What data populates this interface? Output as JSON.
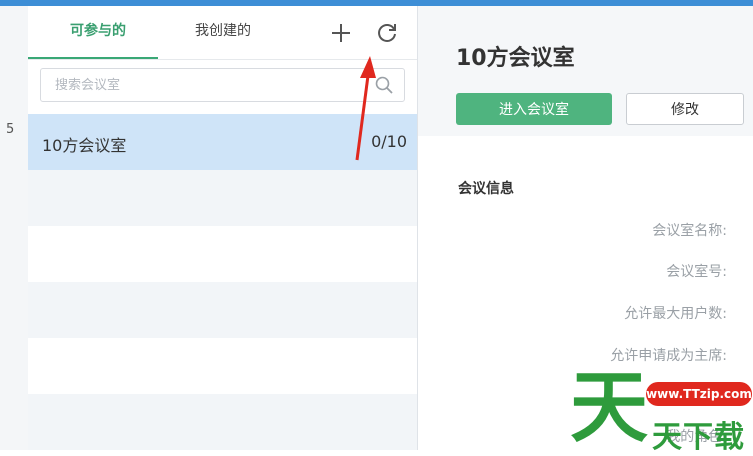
{
  "gutter": {
    "number": "5"
  },
  "tabs": [
    {
      "label": "可参与的",
      "active": true
    },
    {
      "label": "我创建的",
      "active": false
    }
  ],
  "toolbar": {
    "add_icon": "plus-icon",
    "refresh_icon": "refresh-icon"
  },
  "search": {
    "placeholder": "搜索会议室",
    "value": "",
    "icon": "search-icon"
  },
  "rooms": [
    {
      "name": "10方会议室",
      "count": "0/10",
      "selected": true
    }
  ],
  "detail": {
    "title": "10方会议室",
    "enter_button": "进入会议室",
    "edit_button": "修改",
    "section_title": "会议信息",
    "fields": [
      {
        "label": "会议室名称:"
      },
      {
        "label": "会议室号:"
      },
      {
        "label": "允许最大用户数:"
      },
      {
        "label": "允许申请成为主席:"
      },
      {
        "label": "我的角色:"
      }
    ]
  },
  "watermark": {
    "big": "天",
    "url": "www.TTzip.com",
    "sub": "天下载"
  },
  "colors": {
    "accent_green": "#3aa876",
    "button_green": "#4fb47f",
    "selected_row": "#cfe4f8",
    "top_strip": "#3d8ed6",
    "arrow_red": "#e0281e"
  }
}
